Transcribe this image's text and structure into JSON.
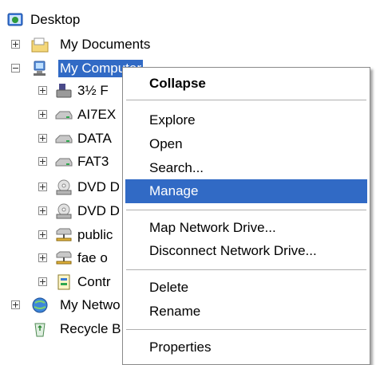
{
  "tree": {
    "root": "Desktop",
    "items": [
      {
        "label": "My Documents",
        "expander": "plus"
      },
      {
        "label": "My Computer",
        "expander": "minus",
        "selected": true
      },
      {
        "label": "3½ F",
        "expander": "plus"
      },
      {
        "label": "AI7EX",
        "expander": "plus"
      },
      {
        "label": "DATA",
        "expander": "plus"
      },
      {
        "label": "FAT3",
        "expander": "plus"
      },
      {
        "label": "DVD D",
        "expander": "plus"
      },
      {
        "label": "DVD D",
        "expander": "plus"
      },
      {
        "label": "public",
        "expander": "plus"
      },
      {
        "label": "fae o",
        "expander": "plus"
      },
      {
        "label": "Contr",
        "expander": "plus"
      },
      {
        "label": "My Netwo",
        "expander": "plus"
      },
      {
        "label": "Recycle B",
        "expander": "none"
      }
    ]
  },
  "context_menu": {
    "items": [
      {
        "label": "Collapse",
        "bold": true
      },
      {
        "label": "Explore"
      },
      {
        "label": "Open"
      },
      {
        "label": "Search..."
      },
      {
        "label": "Manage",
        "highlighted": true
      },
      {
        "label": "Map Network Drive..."
      },
      {
        "label": "Disconnect Network Drive..."
      },
      {
        "label": "Delete"
      },
      {
        "label": "Rename"
      },
      {
        "label": "Properties"
      }
    ]
  },
  "colors": {
    "selection": "#316ac5",
    "menu_border": "#8a8a8a"
  }
}
